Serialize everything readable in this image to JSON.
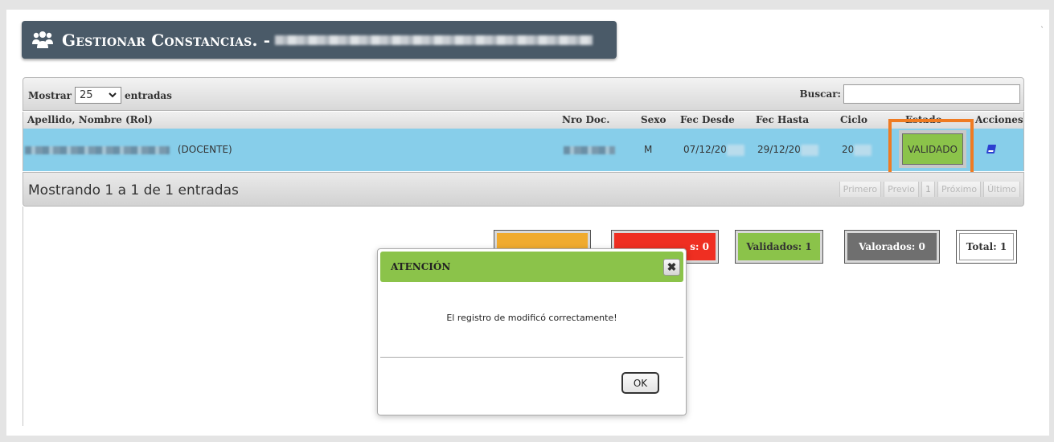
{
  "header": {
    "title": "Gestionar Constancias. -"
  },
  "table_controls": {
    "show_label": "Mostrar",
    "page_length": "25",
    "entries_label": "entradas",
    "search_label": "Buscar:",
    "search_value": ""
  },
  "table": {
    "columns": [
      "Apellido, Nombre (Rol)",
      "Nro Doc.",
      "Sexo",
      "Fec Desde",
      "Fec Hasta",
      "Ciclo",
      "Estado",
      "Acciones"
    ],
    "rows": [
      {
        "rol": "(DOCENTE)",
        "sexo": "M",
        "fec_desde": "07/12/20",
        "fec_hasta": "29/12/20",
        "ciclo": "20",
        "estado": "VALIDADO",
        "accion_icon": "book-icon"
      }
    ]
  },
  "footer": {
    "info": "Mostrando 1 a 1 de 1 entradas",
    "pager": [
      "Primero",
      "Previo",
      "1",
      "Próximo",
      "Último"
    ]
  },
  "counters": [
    {
      "label": ""
    },
    {
      "label": "s: 0"
    },
    {
      "label": "Validados: 1"
    },
    {
      "label": "Valorados: 0"
    },
    {
      "label": "Total: 1"
    }
  ],
  "dialog": {
    "title": "ATENCIÓN",
    "close_glyph": "✖",
    "message": "El registro de modificó correctamente!",
    "ok_label": "OK"
  },
  "colors": {
    "title_bar": "#4a5a68",
    "row_selected": "#87ceea",
    "validado": "#8bc34a",
    "highlight": "#ef7b22",
    "pendiente": "#f0ab2e",
    "rechazado": "#ef2f22",
    "valorado": "#6f6f6f"
  }
}
